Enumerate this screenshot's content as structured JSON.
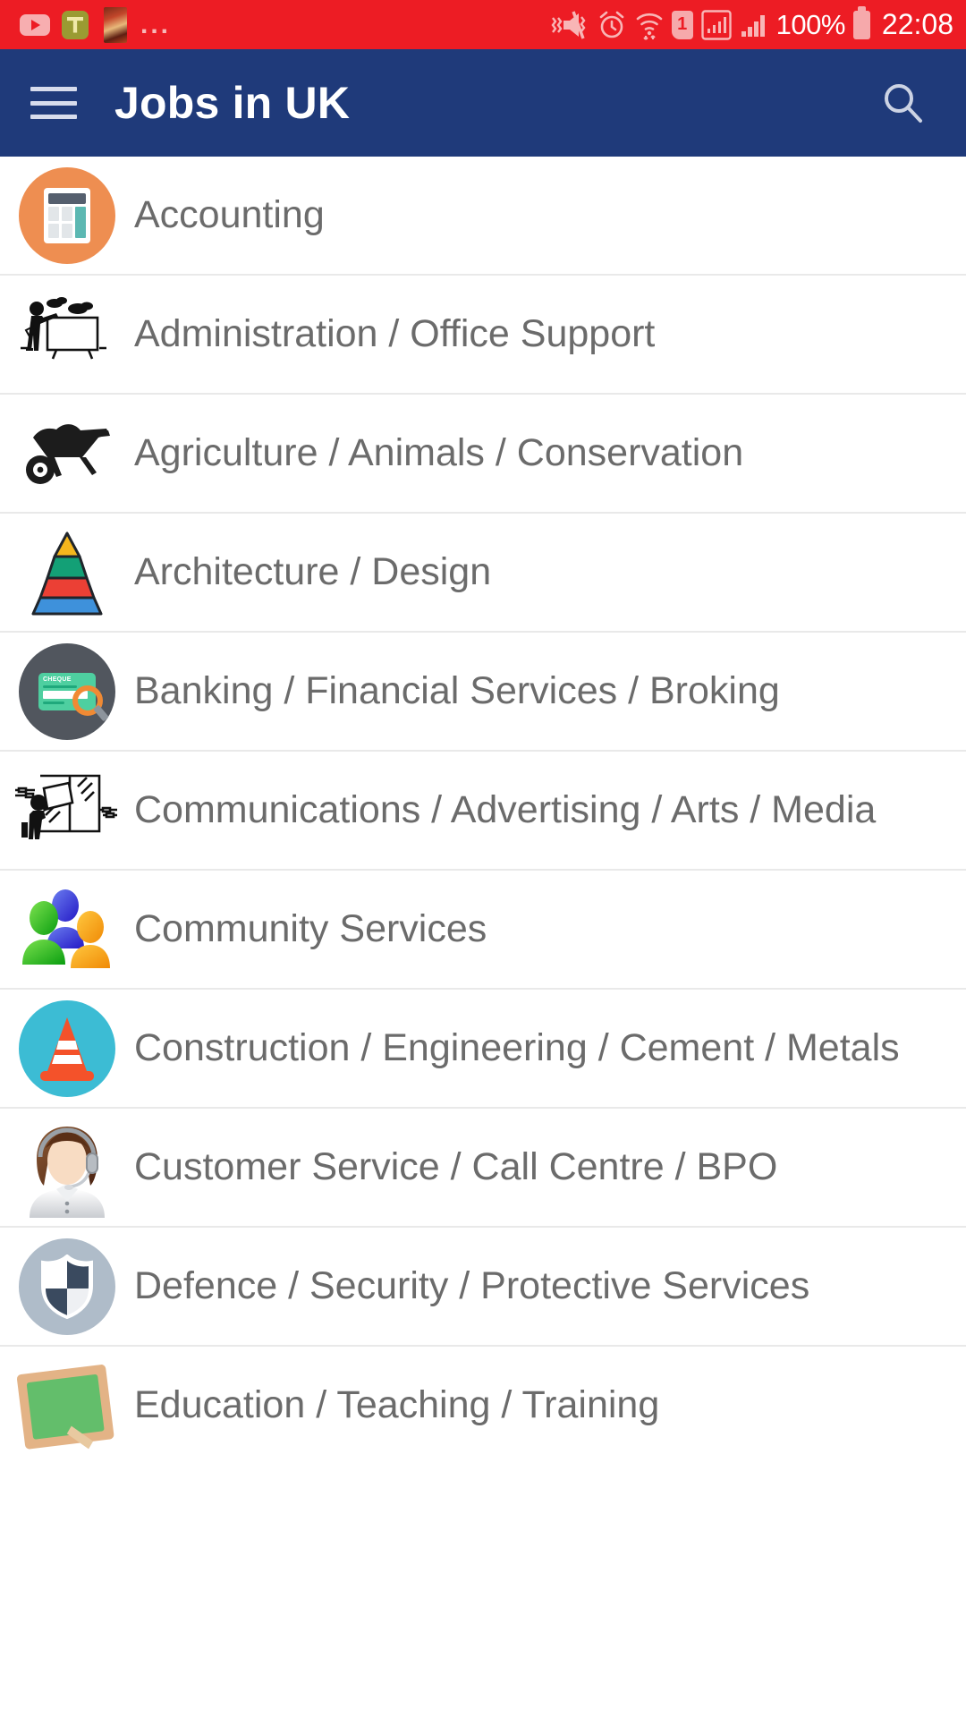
{
  "status_bar": {
    "background_color": "#ED1C24",
    "notifications": [
      {
        "name": "youtube-notification-icon",
        "label": "YouTube"
      },
      {
        "name": "app-notification-icon",
        "label": "App"
      },
      {
        "name": "photo-notification-icon",
        "label": "Photo"
      }
    ],
    "overflow": "...",
    "icons": [
      {
        "name": "vibrate-mute-icon",
        "label": "Silent / Vibrate"
      },
      {
        "name": "alarm-icon",
        "label": "Alarm set"
      },
      {
        "name": "wifi-icon",
        "label": "Wi-Fi connected"
      },
      {
        "name": "sim-card-icon",
        "label": "1"
      },
      {
        "name": "signal-boxed-icon",
        "label": "Mobile data"
      },
      {
        "name": "signal-bars-icon",
        "label": "Signal"
      }
    ],
    "battery_percent": "100%",
    "time": "22:08"
  },
  "app_bar": {
    "background_color": "#1F3A7A",
    "menu_label": "Menu",
    "title": "Jobs in UK",
    "search_label": "Search"
  },
  "list": {
    "items": [
      {
        "label": "Accounting",
        "icon": "calculator-icon",
        "icon_style": "orange-circle-calculator",
        "accent": "#EE8E51"
      },
      {
        "label": "Administration / Office Support",
        "icon": "whiteboard-presenter-icon",
        "icon_style": "black-line-art",
        "accent": "#111111"
      },
      {
        "label": "Agriculture / Animals / Conservation",
        "icon": "wheelbarrow-icon",
        "icon_style": "black-silhouette",
        "accent": "#1c1c1c"
      },
      {
        "label": "Architecture / Design",
        "icon": "pyramid-chart-icon",
        "icon_style": "four-layer-pyramid",
        "accent": "#F5B61D"
      },
      {
        "label": "Banking / Financial Services / Broking",
        "icon": "cheque-magnifier-icon",
        "icon_style": "dark-circle-cheque",
        "accent": "#51565E",
        "cheque_text": "CHEQUE"
      },
      {
        "label": "Communications / Advertising / Arts / Media",
        "icon": "poster-billboard-icon",
        "icon_style": "black-line-art",
        "accent": "#111111"
      },
      {
        "label": "Community Services",
        "icon": "people-group-icon",
        "icon_style": "three-glossy-people",
        "accent": "#25B32A"
      },
      {
        "label": "Construction / Engineering / Cement / Metals",
        "icon": "traffic-cone-icon",
        "icon_style": "cyan-circle-cone",
        "accent": "#3CBCD4"
      },
      {
        "label": "Customer Service / Call Centre / BPO",
        "icon": "headset-agent-icon",
        "icon_style": "illustrated-woman-headset",
        "accent": "#7B4B2A"
      },
      {
        "label": "Defence / Security / Protective Services",
        "icon": "shield-icon",
        "icon_style": "gray-circle-shield",
        "accent": "#AFBCC9"
      },
      {
        "label": "Education / Teaching / Training",
        "icon": "chalkboard-icon",
        "icon_style": "green-chalkboard",
        "accent": "#63BE6B"
      }
    ]
  }
}
